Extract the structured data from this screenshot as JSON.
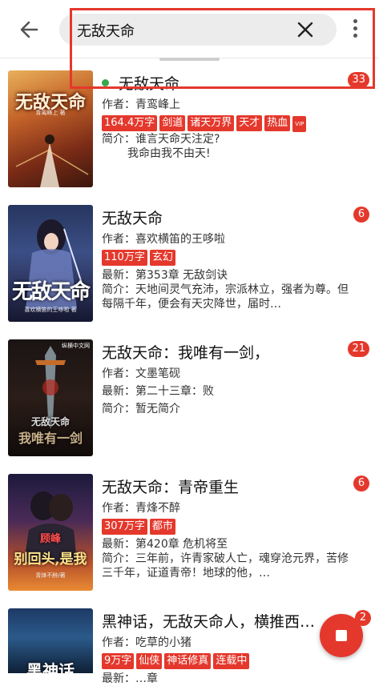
{
  "search": {
    "query": "无敌天命"
  },
  "labels": {
    "author_prefix": "作者：",
    "latest_prefix": "最新：",
    "intro_prefix": "简介："
  },
  "results": [
    {
      "title": "无敌天命",
      "badge": "33",
      "author": "青鸾峰上",
      "tags": [
        "164.4万字",
        "剑道",
        "诸天万界",
        "天才",
        "热血",
        "VIP"
      ],
      "intro_line1": "谁言天命天注定?",
      "intro_line2": "我命由我不由天!",
      "cover": {
        "title": "无敌天命",
        "subtitle": "青鸾峰上 著"
      }
    },
    {
      "title": "无敌天命",
      "badge": "6",
      "author": "喜欢横笛的王哆啦",
      "tags": [
        "110万字",
        "玄幻"
      ],
      "latest": "第353章 无敌剑诀",
      "intro": "天地间灵气充沛，宗派林立，强者为尊。但每隔千年，便会有天灾降世，届时…",
      "cover": {
        "title": "无敌天命",
        "subtitle": "喜欢横笛的王哆啦 著"
      }
    },
    {
      "title": "无敌天命：我唯有一剑，",
      "badge": "21",
      "author": "文墨笔砚",
      "latest": "第二十三章：败",
      "intro": "暂无简介",
      "cover": {
        "title": "无敌天命",
        "subtitle": "我唯有一剑",
        "publisher": "纵横中文网"
      }
    },
    {
      "title": "无敌天命：青帝重生",
      "badge": "6",
      "author": "青烽不醉",
      "tags": [
        "307万字",
        "都市"
      ],
      "latest": "第420章 危机将至",
      "intro": "三年前，许青家破人亡，魂穿沧元界，苦修三千年，证道青帝！地球的他，…",
      "cover": {
        "title": "别回头,是我",
        "subtitle": "青烽不醉/著",
        "top": "顾峰"
      }
    },
    {
      "title": "黑神话，无敌天命人，横推西…",
      "badge": "2",
      "author": "吃草的小猪",
      "tags": [
        "9万字",
        "仙侠",
        "神话修真",
        "连载中"
      ],
      "latest_partial": "最新：…章",
      "cover": {
        "title": "黑神话"
      }
    }
  ],
  "colors": {
    "accent": "#e5382c",
    "live": "#39a74b"
  },
  "icons": {
    "back": "arrow-left-icon",
    "clear": "close-icon",
    "more": "more-vertical-icon",
    "fab": "stop-icon"
  }
}
